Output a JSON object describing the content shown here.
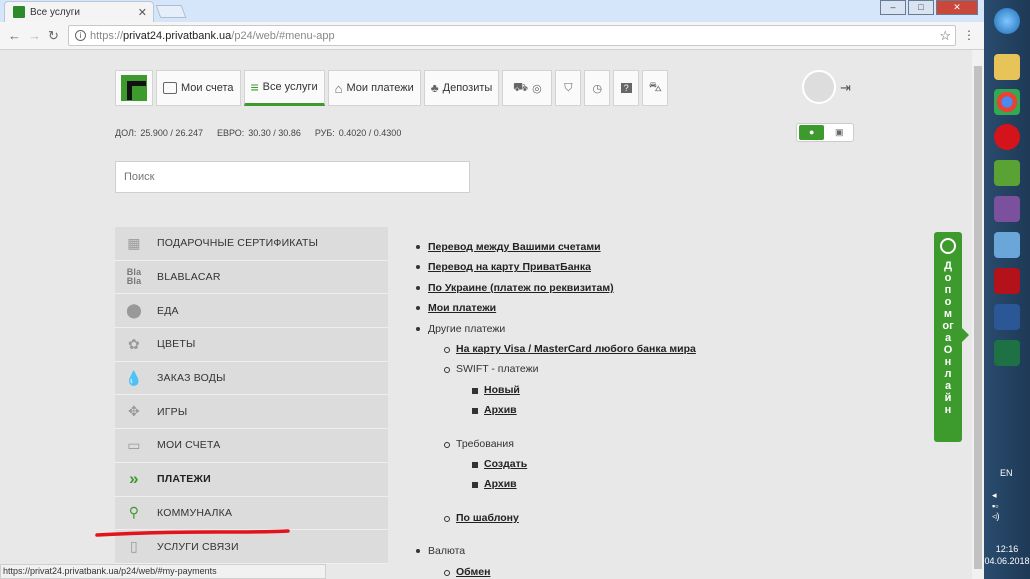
{
  "browser": {
    "tab_title": "Все услуги",
    "tab_close": "✕",
    "url_prefix": "https://",
    "url_host": "privat24.privatbank.ua",
    "url_path": "/p24/web/#menu-app",
    "status_url": "https://privat24.privatbank.ua/p24/web/#my-payments",
    "minimize": "–",
    "maximize": "□",
    "close": "✕"
  },
  "topnav": {
    "my_accounts": "Мои счета",
    "all_services": "Все услуги",
    "my_payments": "Мои платежи",
    "deposits": "Депозиты"
  },
  "rates": {
    "usd_label": "ДОЛ:",
    "usd_value": "25.900 / 26.247",
    "eur_label": "ЕВРО:",
    "eur_value": "30.30 / 30.86",
    "rub_label": "РУБ:",
    "rub_value": "0.4020 / 0.4300"
  },
  "search": {
    "placeholder": "Поиск"
  },
  "menu": {
    "items": [
      {
        "label": "ПОДАРОЧНЫЕ СЕРТИФИКАТЫ",
        "icon": "gift-icon"
      },
      {
        "label": "BLABLACAR",
        "icon": "blablacar-icon",
        "icon_text": "Bla Bla"
      },
      {
        "label": "ЕДА",
        "icon": "food-icon"
      },
      {
        "label": "ЦВЕТЫ",
        "icon": "flower-icon"
      },
      {
        "label": "ЗАКАЗ ВОДЫ",
        "icon": "water-drop-icon"
      },
      {
        "label": "ИГРЫ",
        "icon": "gamepad-icon"
      },
      {
        "label": "МОИ СЧЕТА",
        "icon": "card-icon"
      },
      {
        "label": "ПЛАТЕЖИ",
        "icon": "double-chevron-icon"
      },
      {
        "label": "КОММУНАЛКА",
        "icon": "faucet-icon"
      },
      {
        "label": "УСЛУГИ СВЯЗИ",
        "icon": "phone-icon"
      }
    ]
  },
  "links": {
    "l1": "Перевод между Вашими счетами",
    "l2": "Перевод на карту ПриватБанка",
    "l3": "По Украине (платеж по реквизитам)",
    "l4": "Мои платежи",
    "other": "Другие платежи",
    "visa": "На карту Visa / MasterCard любого банка мира",
    "swift": "SWIFT - платежи",
    "new": "Новый",
    "archive": "Архив",
    "requirements": "Требования",
    "create": "Создать",
    "archive2": "Архив",
    "template": "По шаблону",
    "currency": "Валюта",
    "exchange": "Обмен"
  },
  "help": {
    "label": "ДопомогаОнлайн"
  },
  "taskbar": {
    "lang": "EN",
    "time": "12:16",
    "date": "04.06.2018"
  },
  "colors": {
    "brand_green": "#3d9a2c",
    "underline_red": "#e3131b"
  }
}
